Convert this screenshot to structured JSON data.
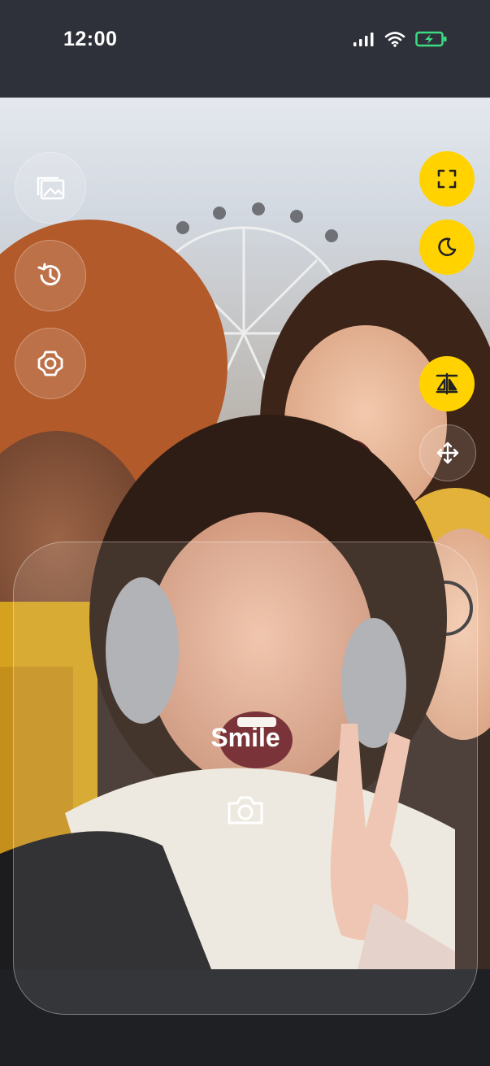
{
  "status_bar": {
    "time": "12:00",
    "icons": [
      "cellular-signal-icon",
      "wifi-icon",
      "battery-charging-icon"
    ],
    "battery_color": "#3ddc84"
  },
  "left_controls": [
    {
      "name": "gallery-button",
      "icon": "gallery-icon"
    },
    {
      "name": "history-button",
      "icon": "history-icon"
    },
    {
      "name": "settings-button",
      "icon": "camera-settings-icon"
    }
  ],
  "right_controls": [
    {
      "name": "fullscreen-button",
      "icon": "fullscreen-icon",
      "style": "yellow"
    },
    {
      "name": "night-mode-button",
      "icon": "moon-icon",
      "style": "yellow"
    },
    {
      "name": "mirror-flip-button",
      "icon": "flip-icon",
      "style": "yellow"
    },
    {
      "name": "move-button",
      "icon": "move-arrows-icon",
      "style": "glass"
    }
  ],
  "panel": {
    "mode_label": "Smile",
    "shutter_icon": "camera-icon"
  },
  "colors": {
    "accent": "#ffd200",
    "status_bar_bg": "#2e3139",
    "bottom_bg": "#1e2024"
  }
}
